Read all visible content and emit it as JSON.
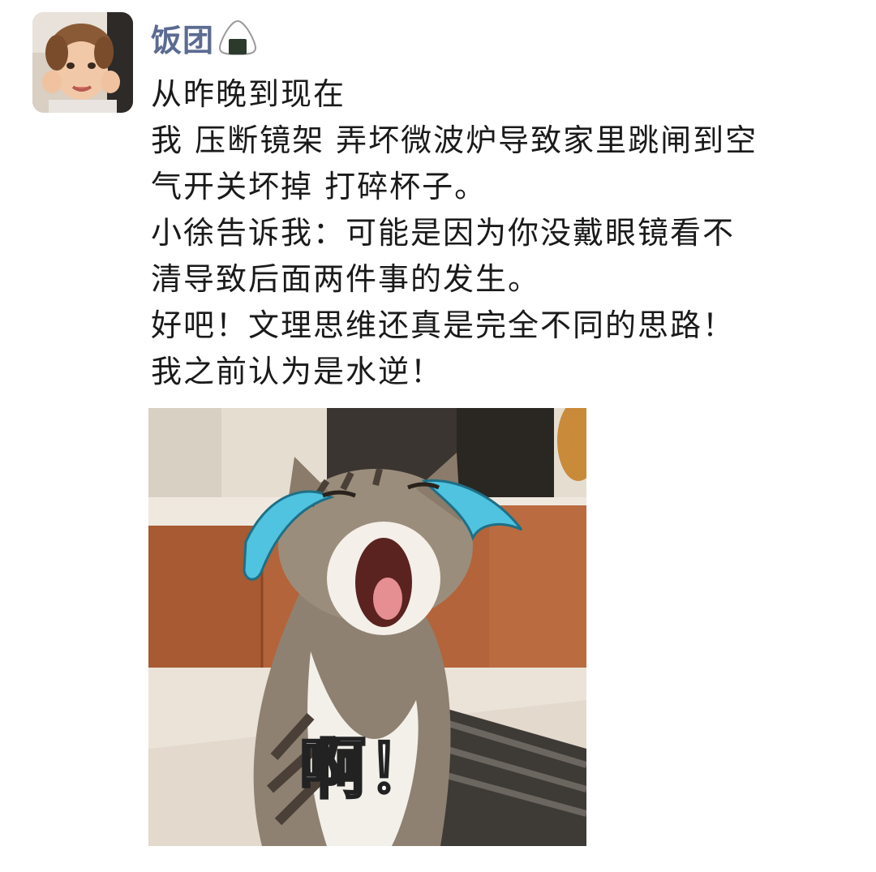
{
  "post": {
    "author": "饭团",
    "author_icon": "onigiri-icon",
    "lines": [
      "从昨晚到现在",
      "我 压断镜架 弄坏微波炉导致家里跳闸到空",
      "气开关坏掉 打碎杯子。",
      "小徐告诉我：可能是因为你没戴眼镜看不",
      "清导致后面两件事的发生。",
      "好吧！文理思维还真是完全不同的思路！",
      "我之前认为是水逆！"
    ],
    "image": {
      "caption": "啊！",
      "tear_color": "#4fc3e0"
    }
  },
  "colors": {
    "author_name": "#5b6b92",
    "text": "#1a1a1a",
    "background": "#ffffff"
  }
}
